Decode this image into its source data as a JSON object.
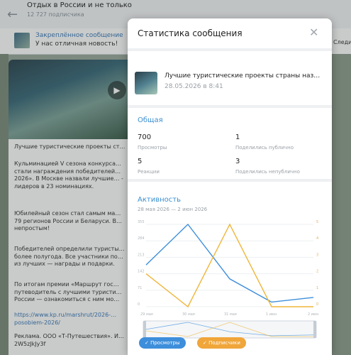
{
  "background": {
    "chat_title": "Отдых в России и не только",
    "chat_subtitle": "12 727 подписчика",
    "back_icon": "arrow-left-icon",
    "pinned_title": "Закреплённое сообщение",
    "pinned_text": "У нас отличная новость!",
    "pinned_right": "Следить",
    "post_paragraphs": [
      "Лучшие туристические проекты ст…",
      "Кульминацией V сезона конкурса… стали награждения победителей… 2026». В Москве назвали лучшие… - лидеров в 23 номинациях.",
      "Юбилейный сезон стал самым ма… 79 регионов России и Беларуси. В… непростым!",
      "Победителей определили туристы… более полугода. Все участники по… из лучших — награды и подарки.",
      "По итогам премии «Маршрут гос… путеводитель с лучшими туристи… России — ознакомиться с ним мо…"
    ],
    "post_link": "https://www.kp.ru/marshrut/2026-… posobiem-2026/",
    "post_ad": "Реклама. ООО «Т-Путешествия». И… 2W5zJkJy3f"
  },
  "modal": {
    "title": "Статистика сообщения",
    "close_icon": "close-icon",
    "message_title": "Лучшие туристические проекты страны наз…",
    "message_date": "28.05.2026 в 8:41",
    "general": {
      "title": "Общая",
      "stats": [
        {
          "value": "700",
          "label": "Просмотры"
        },
        {
          "value": "1",
          "label": "Поделились публично"
        },
        {
          "value": "5",
          "label": "Реакции"
        },
        {
          "value": "3",
          "label": "Поделились непублично"
        }
      ]
    },
    "activity": {
      "title": "Активность",
      "range": "28 мая 2026 — 2 июн 2026"
    },
    "buttons": {
      "views": "✓ Просмотры",
      "subs": "✓ Подписчики"
    }
  },
  "colors": {
    "views": "#3d8edb",
    "subs": "#f0b63a",
    "accent": "#3a8fd0"
  },
  "chart_data": {
    "type": "line",
    "x": [
      "29 мая",
      "30 мая",
      "31 мая",
      "1 июн",
      "2 июн"
    ],
    "y_left_ticks": [
      "0",
      "71",
      "142",
      "213",
      "284",
      "355"
    ],
    "y_right_ticks": [
      "0",
      "1",
      "2",
      "3",
      "4",
      "5"
    ],
    "series": [
      {
        "name": "Просмотры",
        "axis": "left",
        "values": [
          180,
          355,
          120,
          20,
          40
        ]
      },
      {
        "name": "Подписчики",
        "axis": "right",
        "values": [
          2,
          0,
          5,
          0,
          0
        ]
      }
    ]
  }
}
